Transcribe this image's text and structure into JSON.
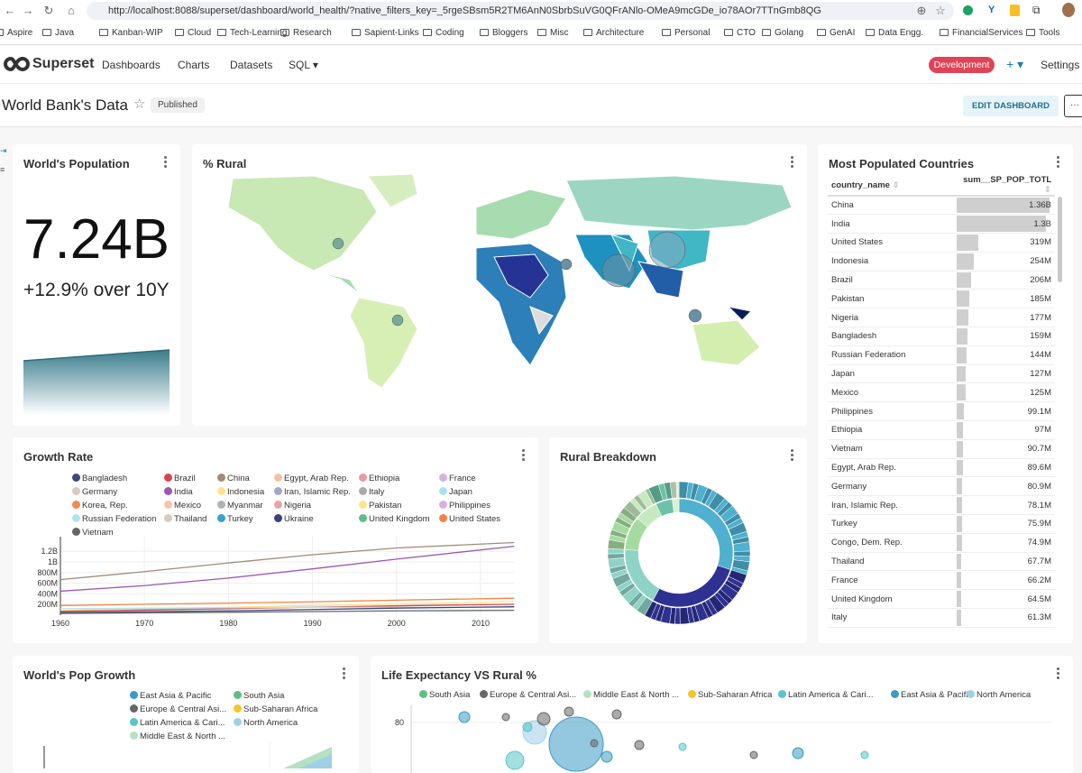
{
  "browser": {
    "url": "http://localhost:8088/superset/dashboard/world_health/?native_filters_key=_5rgeSBsm5R2TM6AnN0SbrbSuVG0QFrANlo-OMeA9mcGDe_io78AOr7TTnGmb8QG",
    "bookmarks": [
      "Aspire",
      "Java",
      "Kanban-WIP",
      "Cloud",
      "Tech-Learning",
      "Research",
      "Sapient-Links",
      "Coding",
      "Bloggers",
      "Misc",
      "Architecture",
      "Personal",
      "CTO",
      "Golang",
      "GenAI",
      "Data Engg.",
      "FinancialServices",
      "Tools"
    ]
  },
  "nav": {
    "brand": "Superset",
    "items": [
      "Dashboards",
      "Charts",
      "Datasets",
      "SQL ▾"
    ],
    "env": "Development",
    "plus": "+ ▾",
    "settings": "Settings",
    "env_color": "#e04355"
  },
  "dashboard": {
    "title": "World Bank's Data",
    "status": "Published",
    "edit": "EDIT DASHBOARD",
    "more": "···"
  },
  "big_number": {
    "title": "World's Population",
    "value": "7.24B",
    "subheader": "+12.9% over 10Y"
  },
  "map": {
    "title": "% Rural"
  },
  "table": {
    "title": "Most Populated Countries",
    "columns": [
      "country_name",
      "sum__SP_POP_TOTL"
    ],
    "rows": [
      [
        "China",
        "1.36B",
        1.36
      ],
      [
        "India",
        "1.3B",
        1.3
      ],
      [
        "United States",
        "319M",
        0.319
      ],
      [
        "Indonesia",
        "254M",
        0.254
      ],
      [
        "Brazil",
        "206M",
        0.206
      ],
      [
        "Pakistan",
        "185M",
        0.185
      ],
      [
        "Nigeria",
        "177M",
        0.177
      ],
      [
        "Bangladesh",
        "159M",
        0.159
      ],
      [
        "Russian Federation",
        "144M",
        0.144
      ],
      [
        "Japan",
        "127M",
        0.127
      ],
      [
        "Mexico",
        "125M",
        0.125
      ],
      [
        "Philippines",
        "99.1M",
        0.0991
      ],
      [
        "Ethiopia",
        "97M",
        0.097
      ],
      [
        "Vietnam",
        "90.7M",
        0.0907
      ],
      [
        "Egypt, Arab Rep.",
        "89.6M",
        0.0896
      ],
      [
        "Germany",
        "80.9M",
        0.0809
      ],
      [
        "Iran, Islamic Rep.",
        "78.1M",
        0.0781
      ],
      [
        "Turkey",
        "75.9M",
        0.0759
      ],
      [
        "Congo, Dem. Rep.",
        "74.9M",
        0.0749
      ],
      [
        "Thailand",
        "67.7M",
        0.0677
      ],
      [
        "France",
        "66.2M",
        0.0662
      ],
      [
        "United Kingdom",
        "64.5M",
        0.0645
      ],
      [
        "Italy",
        "61.3M",
        0.0613
      ]
    ]
  },
  "growth": {
    "title": "Growth Rate",
    "legend": [
      [
        "Bangladesh",
        "#3b4a7a"
      ],
      [
        "Brazil",
        "#d9434f"
      ],
      [
        "China",
        "#a08b78"
      ],
      [
        "Egypt, Arab Rep.",
        "#f6c09f"
      ],
      [
        "Ethiopia",
        "#e89aa0"
      ],
      [
        "France",
        "#d7b3dc"
      ],
      [
        "Germany",
        "#d5ccc2"
      ],
      [
        "India",
        "#9c55b8"
      ],
      [
        "Indonesia",
        "#fde58a"
      ],
      [
        "Iran, Islamic Rep.",
        "#a4a8c3"
      ],
      [
        "Italy",
        "#a9a9a9"
      ],
      [
        "Japan",
        "#a8e3e8"
      ],
      [
        "Korea, Rep.",
        "#f28a4c"
      ],
      [
        "Mexico",
        "#f8c3a4"
      ],
      [
        "Myanmar",
        "#aeb3b5"
      ],
      [
        "Nigeria",
        "#eba3a8"
      ],
      [
        "Pakistan",
        "#fde683"
      ],
      [
        "Philippines",
        "#d6b1e0"
      ],
      [
        "Russian Federation",
        "#ace6ea"
      ],
      [
        "Thailand",
        "#d8cabe"
      ],
      [
        "Turkey",
        "#3aa1c7"
      ],
      [
        "Ukraine",
        "#3c3e7d"
      ],
      [
        "United Kingdom",
        "#5ebe83"
      ],
      [
        "United States",
        "#f28343"
      ],
      [
        "Vietnam",
        "#666666"
      ]
    ]
  },
  "chart_data": [
    {
      "type": "line",
      "title": "Growth Rate",
      "x": [
        1960,
        1970,
        1980,
        1990,
        2000,
        2014
      ],
      "ylim": [
        0,
        1400000000
      ],
      "yticks": [
        "200M",
        "400M",
        "600M",
        "800M",
        "1B",
        "1.2B"
      ],
      "xticks": [
        "1960",
        "1970",
        "1980",
        "1990",
        "2000",
        "2010"
      ],
      "series": [
        {
          "name": "China",
          "color": "#a08b78",
          "values": [
            667000000.0,
            818000000.0,
            981000000.0,
            1135000000.0,
            1263000000.0,
            1364000000.0
          ]
        },
        {
          "name": "India",
          "color": "#9c55b8",
          "values": [
            450000000.0,
            555000000.0,
            697000000.0,
            870000000.0,
            1053000000.0,
            1295000000.0
          ]
        },
        {
          "name": "United States",
          "color": "#f28343",
          "values": [
            181000000.0,
            205000000.0,
            227000000.0,
            250000000.0,
            282000000.0,
            319000000.0
          ]
        },
        {
          "name": "Indonesia",
          "color": "#fde58a",
          "values": [
            88000000.0,
            115000000.0,
            147000000.0,
            181000000.0,
            211000000.0,
            254000000.0
          ]
        },
        {
          "name": "Brazil",
          "color": "#d9434f",
          "values": [
            72000000.0,
            96000000.0,
            121000000.0,
            150000000.0,
            175000000.0,
            206000000.0
          ]
        },
        {
          "name": "Russian Federation",
          "color": "#ace6ea",
          "values": [
            120000000.0,
            130000000.0,
            139000000.0,
            148000000.0,
            146000000.0,
            144000000.0
          ]
        },
        {
          "name": "Bangladesh",
          "color": "#3b4a7a",
          "values": [
            48000000.0,
            65000000.0,
            80000000.0,
            106000000.0,
            132000000.0,
            159000000.0
          ]
        },
        {
          "name": "Vietnam",
          "color": "#666666",
          "values": [
            32000000.0,
            43000000.0,
            54000000.0,
            68000000.0,
            80000000.0,
            91000000.0
          ]
        }
      ]
    },
    {
      "type": "pie",
      "title": "Rural Breakdown",
      "categories": [
        "East Asia & Pacific",
        "South Asia",
        "Sub-Saharan Africa",
        "Europe & Central Asia",
        "Latin America & Caribbean",
        "Middle East & North Africa",
        "North America"
      ],
      "values": [
        30,
        28,
        18,
        10,
        7,
        5,
        2
      ]
    },
    {
      "type": "area",
      "title": "World's Pop Growth",
      "legend": [
        [
          "East Asia & Pacific",
          "#3a9bc6"
        ],
        [
          "South Asia",
          "#5ebe83"
        ],
        [
          "Europe & Central Asi...",
          "#666666"
        ],
        [
          "Sub-Saharan Africa",
          "#f4c42b"
        ],
        [
          "Latin America & Cari...",
          "#58c5c7"
        ],
        [
          "North America",
          "#9fd0e6"
        ],
        [
          "Middle East & North ...",
          "#b6e0c2"
        ]
      ]
    },
    {
      "type": "scatter",
      "title": "Life Expectancy VS Rural %",
      "yticks": [
        "80"
      ],
      "legend": [
        [
          "South Asia",
          "#5ebe83"
        ],
        [
          "Europe & Central Asi...",
          "#666666"
        ],
        [
          "Middle East & North ...",
          "#b6e0c2"
        ],
        [
          "Sub-Saharan Africa",
          "#f4c42b"
        ],
        [
          "Latin America & Cari...",
          "#58c5c7"
        ],
        [
          "East Asia & Pacific",
          "#3a9bc6"
        ],
        [
          "North America",
          "#9fd0e6"
        ]
      ]
    }
  ]
}
